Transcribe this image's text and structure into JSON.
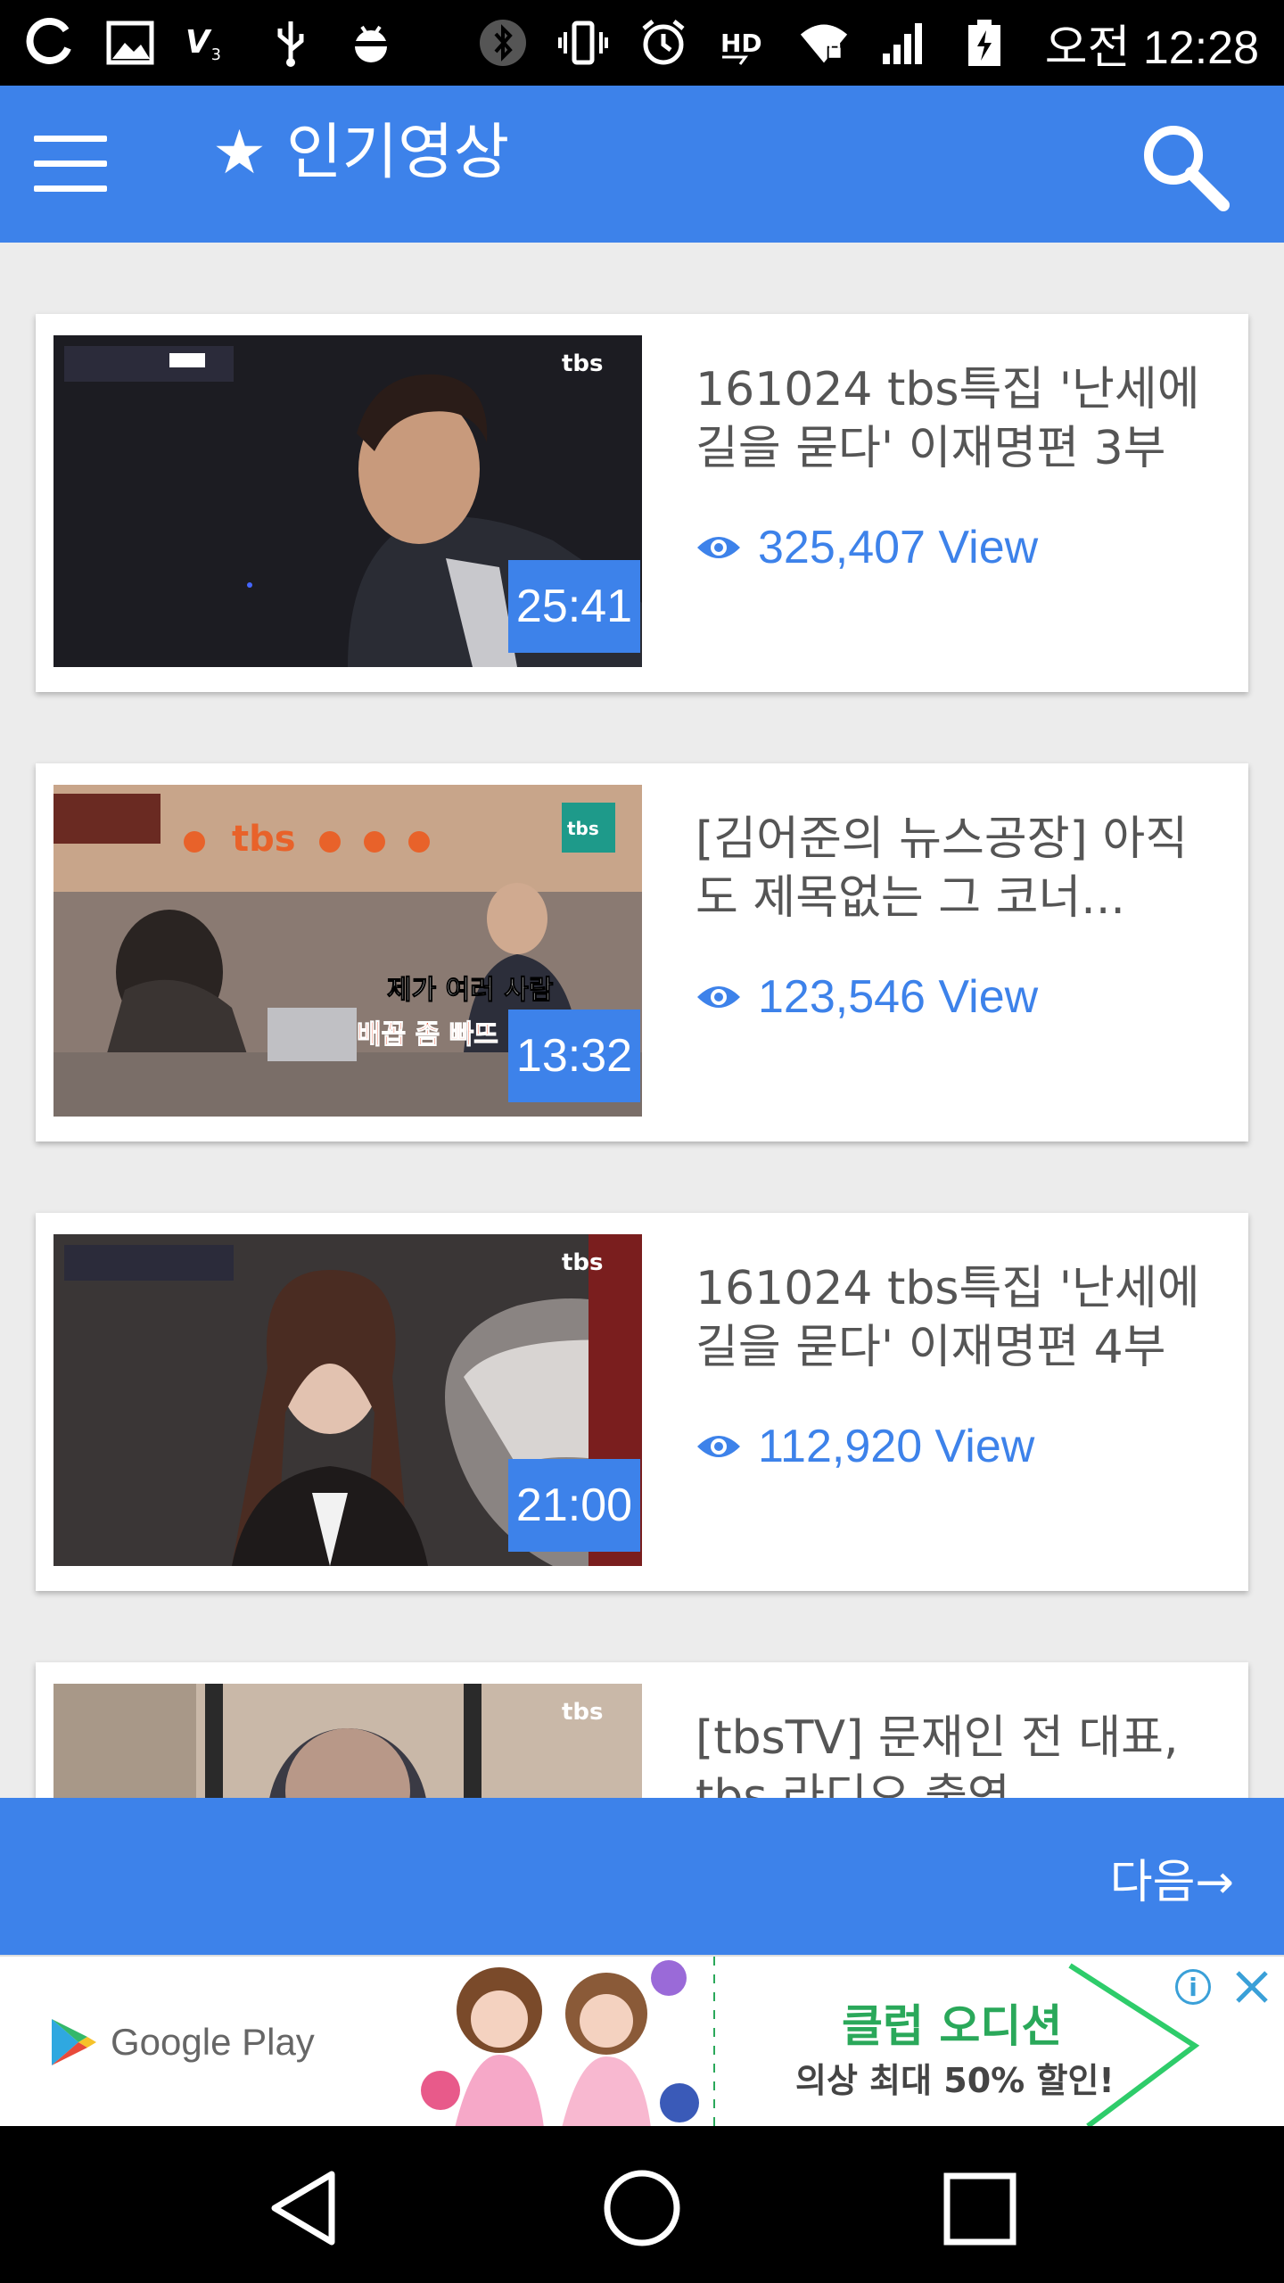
{
  "status_bar": {
    "time": "오전 12:28",
    "left_icons": [
      "sync-icon",
      "image-icon",
      "v3-icon",
      "usb-icon",
      "android-debug-icon"
    ],
    "right_icons": [
      "bluetooth-icon",
      "vibrate-icon",
      "alarm-icon",
      "hd-icon",
      "wifi-icon",
      "signal-icon",
      "battery-icon"
    ]
  },
  "app_bar": {
    "title": "인기영상",
    "title_star": "★"
  },
  "videos": [
    {
      "title": "161024 tbs특집 '난세에 길을 묻다' 이재명편 3부",
      "views": "325,407 View",
      "duration": "25:41"
    },
    {
      "title": "[김어준의 뉴스공장] 아직도 제목없는 그 코너...",
      "views": "123,546 View",
      "duration": "13:32"
    },
    {
      "title": "161024 tbs특집 '난세에 길을 묻다' 이재명편 4부",
      "views": "112,920 View",
      "duration": "21:00"
    },
    {
      "title": "[tbsTV] 문재인 전 대표, tbs 라디오 출연",
      "views": "",
      "duration": ""
    }
  ],
  "next_button": {
    "label": "다음→"
  },
  "ad": {
    "store": "Google Play",
    "headline": "클럽 오디션",
    "subline": "의상 최대 50% 할인!",
    "info_glyph": "i"
  },
  "colors": {
    "primary": "#3d82ea",
    "background": "#ececec",
    "ad_green": "#2aa85a"
  }
}
